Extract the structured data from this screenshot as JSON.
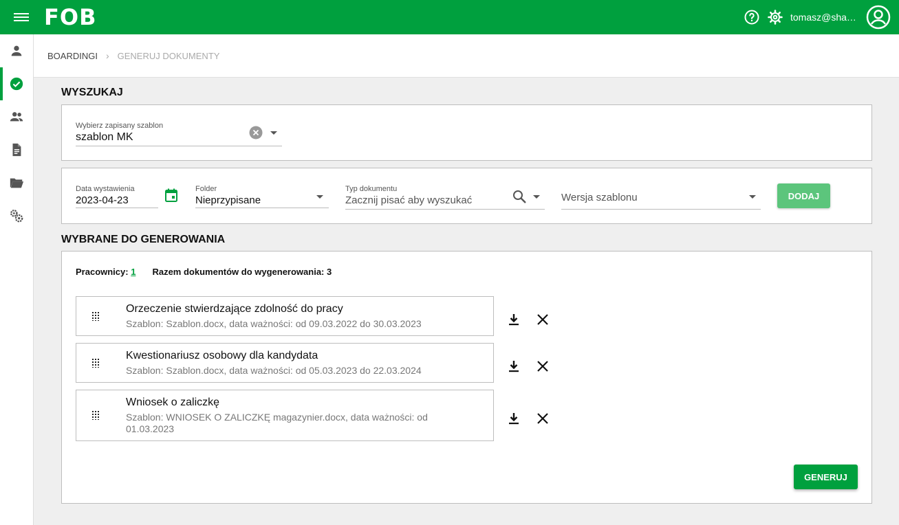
{
  "app": {
    "logo": "FOB",
    "user_email": "tomasz@sharecraft.pl"
  },
  "colors": {
    "brand": "#00a03e",
    "brand_light": "#5cc57c"
  },
  "icons": {
    "menu": "hamburger-icon",
    "help": "help-circle-icon",
    "settings": "gear-icon",
    "account": "account-circle-icon",
    "sidebar": [
      "person-icon",
      "check-circle-icon",
      "group-icon",
      "document-icon",
      "folder-open-icon",
      "gears-icon"
    ]
  },
  "breadcrumb": {
    "parent": "BOARDINGI",
    "current": "GENERUJ DOKUMENTY"
  },
  "search": {
    "title": "WYSZUKAJ",
    "template_label": "Wybierz zapisany szablon",
    "template_value": "szablon MK"
  },
  "filters": {
    "date_label": "Data wystawienia",
    "date_value": "2023-04-23",
    "folder_label": "Folder",
    "folder_value": "Nieprzypisane",
    "type_label": "Typ dokumentu",
    "type_placeholder": "Zacznij pisać aby wyszukać",
    "version_placeholder": "Wersja szablonu",
    "add_button": "DODAJ"
  },
  "selected": {
    "title": "WYBRANE DO GENEROWANIA",
    "workers_label": "Pracownicy:",
    "workers_count": "1",
    "total_label": "Razem dokumentów do wygenerowania: 3",
    "documents": [
      {
        "title": "Orzeczenie stwierdzające zdolność do pracy",
        "subtitle": "Szablon: Szablon.docx, data ważności: od 09.03.2022 do 30.03.2023"
      },
      {
        "title": "Kwestionariusz osobowy dla kandydata",
        "subtitle": "Szablon: Szablon.docx, data ważności: od 05.03.2023 do 22.03.2024"
      },
      {
        "title": "Wniosek o zaliczkę",
        "subtitle": "Szablon: WNIOSEK O ZALICZKĘ magazynier.docx, data ważności: od 01.03.2023"
      }
    ],
    "generate_button": "GENERUJ"
  }
}
